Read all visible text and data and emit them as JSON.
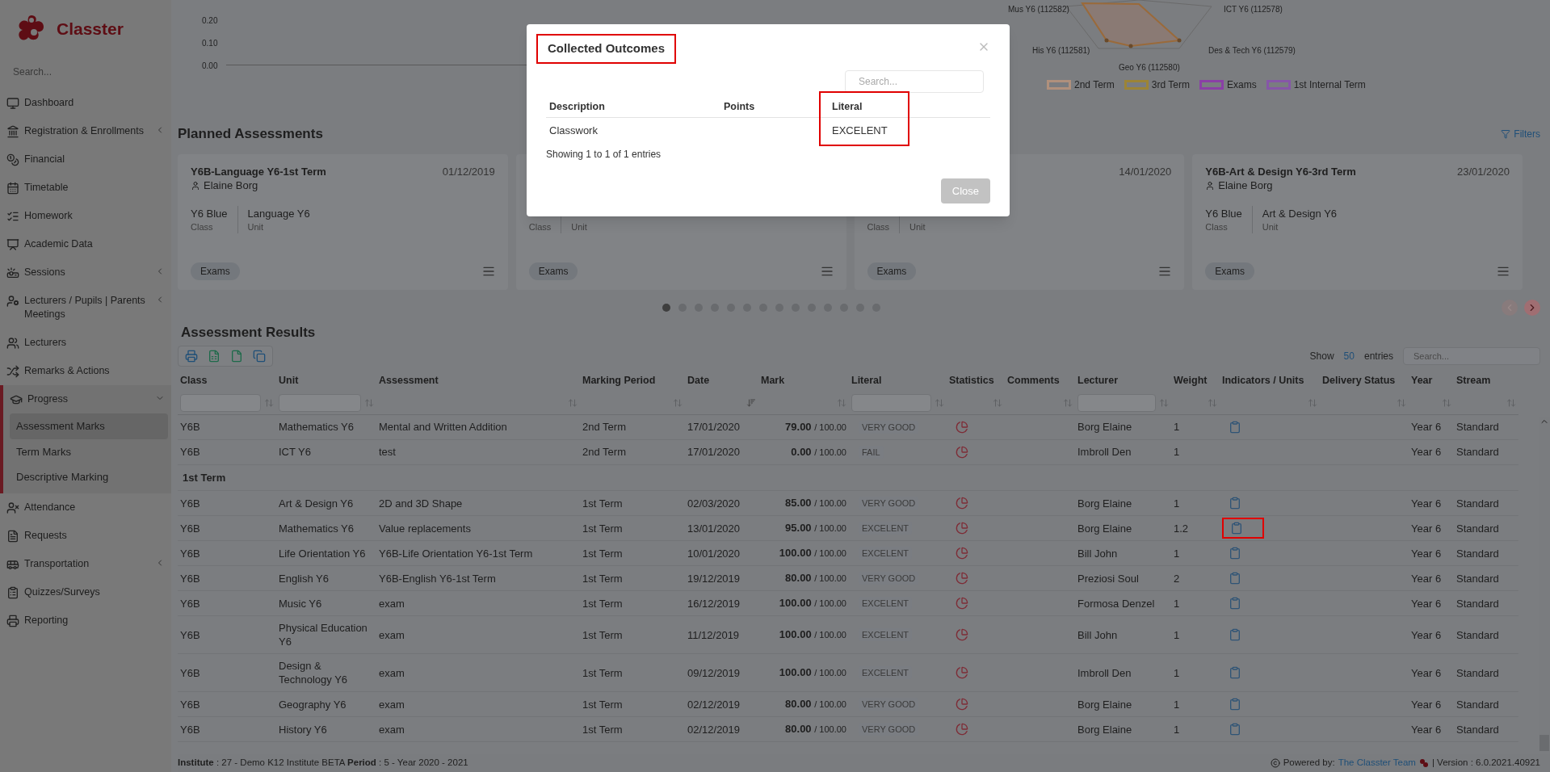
{
  "sidebar": {
    "brand": "Classter",
    "search_placeholder": "Search...",
    "items": [
      {
        "label": "Dashboard",
        "has_submenu": false
      },
      {
        "label": "Registration & Enrollments",
        "has_submenu": true,
        "expanded": false
      },
      {
        "label": "Financial",
        "has_submenu": false
      },
      {
        "label": "Timetable",
        "has_submenu": false
      },
      {
        "label": "Homework",
        "has_submenu": false
      },
      {
        "label": "Academic Data",
        "has_submenu": false
      },
      {
        "label": "Sessions",
        "has_submenu": true,
        "expanded": false
      },
      {
        "label": "Lecturers / Pupils | Parents Meetings",
        "has_submenu": true,
        "expanded": false
      },
      {
        "label": "Lecturers",
        "has_submenu": false
      },
      {
        "label": "Remarks & Actions",
        "has_submenu": false
      },
      {
        "label": "Progress",
        "has_submenu": true,
        "expanded": true,
        "children": [
          {
            "label": "Assessment Marks",
            "selected": true
          },
          {
            "label": "Term Marks",
            "selected": false
          },
          {
            "label": "Descriptive Marking",
            "selected": false
          }
        ]
      },
      {
        "label": "Attendance",
        "has_submenu": false
      },
      {
        "label": "Requests",
        "has_submenu": false
      },
      {
        "label": "Transportation",
        "has_submenu": true,
        "expanded": false
      },
      {
        "label": "Quizzes/Surveys",
        "has_submenu": false
      },
      {
        "label": "Reporting",
        "has_submenu": false
      }
    ]
  },
  "top_chart": {
    "yticks": [
      "0.20",
      "0.10",
      "0.00"
    ],
    "radar_labels": [
      "Mus Y6 (112582)",
      "ICT Y6 (112578)",
      "His Y6 (112581)",
      "Des & Tech Y6 (112579)",
      "Geo Y6 (112580)"
    ],
    "legend": [
      {
        "label": "2nd Term",
        "color": "#b0907c"
      },
      {
        "label": "3rd Term",
        "color": "#9c8436"
      },
      {
        "label": "Exams",
        "color": "#8a3fa6"
      },
      {
        "label": "1st Internal Term",
        "color": "#8656a8"
      }
    ]
  },
  "planned": {
    "title": "Planned Assessments",
    "filters": "Filters",
    "cards": [
      {
        "title": "Y6B-Language Y6-1st Term",
        "date": "01/12/2019",
        "person": "Elaine Borg",
        "class_value": "Y6 Blue",
        "class_label": "Class",
        "unit_value": "Language Y6",
        "unit_label": "Unit",
        "tag": "Exams"
      },
      {
        "class_label": "Class",
        "unit_label": "Unit",
        "tag": "Exams"
      },
      {
        "date": "14/01/2020",
        "class_label": "Class",
        "unit_label": "Unit",
        "tag": "Exams"
      },
      {
        "title": "Y6B-Art & Design Y6-3rd Term",
        "date": "23/01/2020",
        "person": "Elaine Borg",
        "class_value": "Y6 Blue",
        "class_label": "Class",
        "unit_value": "Art & Design Y6",
        "unit_label": "Unit",
        "tag": "Exams"
      }
    ],
    "pages": [
      {
        "selected": true
      },
      {
        "selected": false
      },
      {
        "selected": false
      },
      {
        "selected": false
      },
      {
        "selected": false
      },
      {
        "selected": false
      },
      {
        "selected": false
      },
      {
        "selected": false
      },
      {
        "selected": false
      },
      {
        "selected": false
      },
      {
        "selected": false
      },
      {
        "selected": false
      },
      {
        "selected": false
      },
      {
        "selected": false
      }
    ]
  },
  "results": {
    "title": "Assessment Results",
    "show_label": "Show",
    "page_size": "50",
    "entries_label": "entries",
    "search_placeholder": "Search...",
    "columns": [
      {
        "label": "Class",
        "filter_field": true,
        "sorted": false
      },
      {
        "label": "Unit",
        "filter_field": true,
        "sorted": false
      },
      {
        "label": "Assessment",
        "filter_field": false,
        "sorted": false
      },
      {
        "label": "Marking Period",
        "filter_field": false,
        "sorted": false
      },
      {
        "label": "Date",
        "filter_field": false,
        "sorted": true
      },
      {
        "label": "Mark",
        "filter_field": false,
        "sorted": false
      },
      {
        "label": "Literal",
        "filter_field": true,
        "sorted": false
      },
      {
        "label": "Statistics",
        "filter_field": false,
        "sorted": false
      },
      {
        "label": "Comments",
        "filter_field": false,
        "sorted": false
      },
      {
        "label": "Lecturer",
        "filter_field": true,
        "sorted": false
      },
      {
        "label": "Weight",
        "filter_field": false,
        "sorted": false
      },
      {
        "label": "Indicators / Units",
        "filter_field": false,
        "sorted": false
      },
      {
        "label": "Delivery Status",
        "filter_field": false,
        "sorted": false
      },
      {
        "label": "Year",
        "filter_field": false,
        "sorted": false
      },
      {
        "label": "Stream",
        "filter_field": false,
        "sorted": false
      }
    ],
    "rows": [
      {
        "kind": "data",
        "class": "Y6B",
        "unit": "Mathematics Y6",
        "assessment": "Mental and Written Addition",
        "period": "2nd Term",
        "date": "17/01/2020",
        "mark": "79.00",
        "max": "/ 100.00",
        "literal": "VERY GOOD",
        "lecturer": "Borg Elaine",
        "weight": "1",
        "indicator": true,
        "highlighted": false,
        "year": "Year 6",
        "stream": "Standard"
      },
      {
        "kind": "data",
        "class": "Y6B",
        "unit": "ICT Y6",
        "assessment": "test",
        "period": "2nd Term",
        "date": "17/01/2020",
        "mark": "0.00",
        "max": "/ 100.00",
        "literal": "FAIL",
        "lecturer": "Imbroll Den",
        "weight": "1",
        "indicator": false,
        "highlighted": false,
        "year": "Year 6",
        "stream": "Standard"
      },
      {
        "kind": "group",
        "label": "1st Term"
      },
      {
        "kind": "data",
        "class": "Y6B",
        "unit": "Art & Design Y6",
        "assessment": "2D and 3D Shape",
        "period": "1st Term",
        "date": "02/03/2020",
        "mark": "85.00",
        "max": "/ 100.00",
        "literal": "VERY GOOD",
        "lecturer": "Borg Elaine",
        "weight": "1",
        "indicator": true,
        "highlighted": false,
        "year": "Year 6",
        "stream": "Standard"
      },
      {
        "kind": "data",
        "class": "Y6B",
        "unit": "Mathematics Y6",
        "assessment": "Value replacements",
        "period": "1st Term",
        "date": "13/01/2020",
        "mark": "95.00",
        "max": "/ 100.00",
        "literal": "EXCELENT",
        "lecturer": "Borg Elaine",
        "weight": "1.2",
        "indicator": true,
        "highlighted": true,
        "year": "Year 6",
        "stream": "Standard"
      },
      {
        "kind": "data",
        "class": "Y6B",
        "unit": "Life Orientation Y6",
        "assessment": "Y6B-Life Orientation Y6-1st Term",
        "period": "1st Term",
        "date": "10/01/2020",
        "mark": "100.00",
        "max": "/ 100.00",
        "literal": "EXCELENT",
        "lecturer": "Bill John",
        "weight": "1",
        "indicator": true,
        "highlighted": false,
        "year": "Year 6",
        "stream": "Standard"
      },
      {
        "kind": "data",
        "class": "Y6B",
        "unit": "English Y6",
        "assessment": "Y6B-English Y6-1st Term",
        "period": "1st Term",
        "date": "19/12/2019",
        "mark": "80.00",
        "max": "/ 100.00",
        "literal": "VERY GOOD",
        "lecturer": "Preziosi Soul",
        "weight": "2",
        "indicator": true,
        "highlighted": false,
        "year": "Year 6",
        "stream": "Standard"
      },
      {
        "kind": "data",
        "class": "Y6B",
        "unit": "Music Y6",
        "assessment": "exam",
        "period": "1st Term",
        "date": "16/12/2019",
        "mark": "100.00",
        "max": "/ 100.00",
        "literal": "EXCELENT",
        "lecturer": "Formosa Denzel",
        "weight": "1",
        "indicator": true,
        "highlighted": false,
        "year": "Year 6",
        "stream": "Standard"
      },
      {
        "kind": "data",
        "class": "Y6B",
        "unit": "Physical Education Y6",
        "assessment": "exam",
        "period": "1st Term",
        "date": "11/12/2019",
        "mark": "100.00",
        "max": "/ 100.00",
        "literal": "EXCELENT",
        "lecturer": "Bill John",
        "weight": "1",
        "indicator": true,
        "highlighted": false,
        "year": "Year 6",
        "stream": "Standard"
      },
      {
        "kind": "data",
        "class": "Y6B",
        "unit": "Design & Technology Y6",
        "assessment": "exam",
        "period": "1st Term",
        "date": "09/12/2019",
        "mark": "100.00",
        "max": "/ 100.00",
        "literal": "EXCELENT",
        "lecturer": "Imbroll Den",
        "weight": "1",
        "indicator": true,
        "highlighted": false,
        "year": "Year 6",
        "stream": "Standard"
      },
      {
        "kind": "data",
        "class": "Y6B",
        "unit": "Geography Y6",
        "assessment": "exam",
        "period": "1st Term",
        "date": "02/12/2019",
        "mark": "80.00",
        "max": "/ 100.00",
        "literal": "VERY GOOD",
        "lecturer": "Borg Elaine",
        "weight": "1",
        "indicator": true,
        "highlighted": false,
        "year": "Year 6",
        "stream": "Standard"
      },
      {
        "kind": "data",
        "class": "Y6B",
        "unit": "History Y6",
        "assessment": "exam",
        "period": "1st Term",
        "date": "02/12/2019",
        "mark": "80.00",
        "max": "/ 100.00",
        "literal": "VERY GOOD",
        "lecturer": "Borg Elaine",
        "weight": "1",
        "indicator": true,
        "highlighted": false,
        "year": "Year 6",
        "stream": "Standard"
      }
    ]
  },
  "footer": {
    "info": "**Institute** : 27 - Demo K12 Institute BETA **Period** : 5 - Year 2020 - 2021",
    "powered_by": "Powered by:",
    "team_link": "The Classter Team",
    "version": "| Version : 6.0.2021.40921"
  },
  "modal": {
    "title": "Collected Outcomes",
    "title_highlighted": true,
    "search_placeholder": "Search...",
    "columns": [
      {
        "label": "Description",
        "highlighted": false
      },
      {
        "label": "Points",
        "highlighted": false
      },
      {
        "label": "Literal",
        "highlighted": true
      }
    ],
    "rows": [
      {
        "description": "Classwork",
        "literal": "EXCELENT"
      }
    ],
    "info": "Showing 1 to 1 of 1 entries",
    "close_button": "Close"
  }
}
